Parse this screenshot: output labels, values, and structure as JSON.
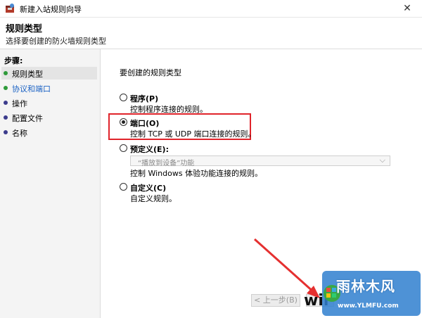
{
  "window": {
    "title": "新建入站规则向导",
    "close_glyph": "✕"
  },
  "header": {
    "title": "规则类型",
    "subtitle": "选择要创建的防火墙规则类型"
  },
  "steps": {
    "title": "步骤:",
    "items": [
      {
        "label": "规则类型",
        "state": "active"
      },
      {
        "label": "协议和端口",
        "state": "current"
      },
      {
        "label": "操作",
        "state": "todo"
      },
      {
        "label": "配置文件",
        "state": "todo"
      },
      {
        "label": "名称",
        "state": "todo"
      }
    ]
  },
  "main": {
    "question": "要创建的规则类型",
    "options": [
      {
        "label": "程序(P)",
        "desc": "控制程序连接的规则。",
        "checked": false
      },
      {
        "label": "端口(O)",
        "desc": "控制 TCP 或 UDP 端口连接的规则。",
        "checked": true
      },
      {
        "label": "预定义(E):",
        "desc": "控制 Windows 体验功能连接的规则。",
        "checked": false
      },
      {
        "label": "自定义(C)",
        "desc": "自定义规则。",
        "checked": false
      }
    ],
    "predefined_select": {
      "value": "“播放到设备”功能",
      "chevron": "⌵"
    }
  },
  "buttons": {
    "back": "< 上一步(B)"
  },
  "watermark": {
    "main": "雨林木风",
    "url": "www.YLMFU.com",
    "partial": "wir"
  },
  "colors": {
    "highlight": "#e0242b",
    "accent_link": "#1b62c4"
  }
}
